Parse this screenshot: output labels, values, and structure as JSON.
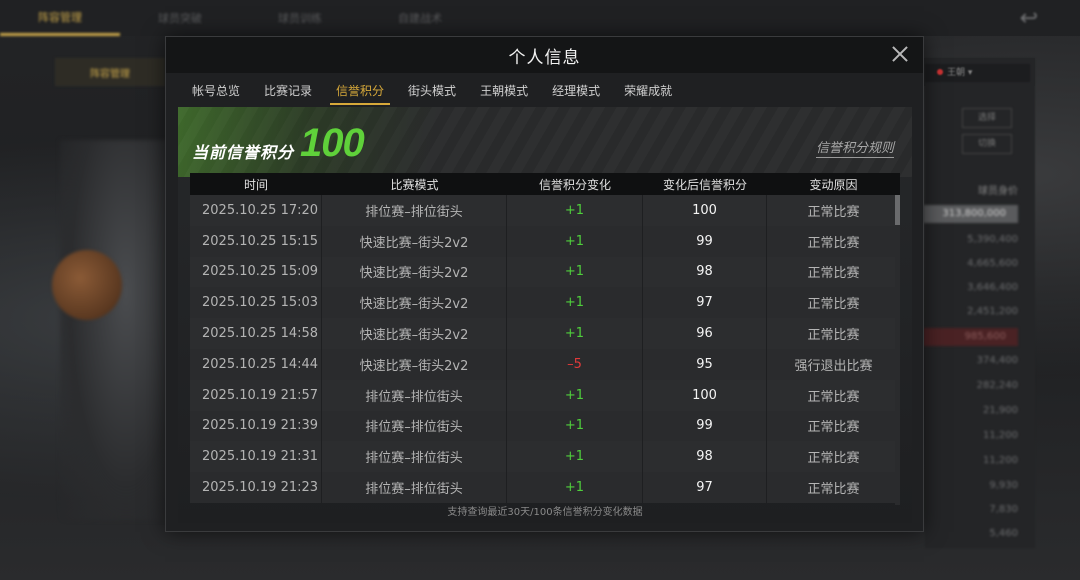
{
  "modal": {
    "title": "个人信息",
    "tabs": [
      {
        "label": "帐号总览",
        "active": false
      },
      {
        "label": "比赛记录",
        "active": false
      },
      {
        "label": "信誉积分",
        "active": true
      },
      {
        "label": "街头模式",
        "active": false
      },
      {
        "label": "王朝模式",
        "active": false
      },
      {
        "label": "经理模式",
        "active": false
      },
      {
        "label": "荣耀成就",
        "active": false
      }
    ],
    "score": {
      "label": "当前信誉积分",
      "value": "100"
    },
    "rules_link": "信誉积分规则",
    "table": {
      "headers": [
        "时间",
        "比赛模式",
        "信誉积分变化",
        "变化后信誉积分",
        "变动原因"
      ],
      "rows": [
        {
          "time": "2025.10.25  17:20",
          "mode": "排位赛–排位街头",
          "change": "+1",
          "after": "100",
          "reason": "正常比赛"
        },
        {
          "time": "2025.10.25  15:15",
          "mode": "快速比赛–街头2v2",
          "change": "+1",
          "after": "99",
          "reason": "正常比赛"
        },
        {
          "time": "2025.10.25  15:09",
          "mode": "快速比赛–街头2v2",
          "change": "+1",
          "after": "98",
          "reason": "正常比赛"
        },
        {
          "time": "2025.10.25  15:03",
          "mode": "快速比赛–街头2v2",
          "change": "+1",
          "after": "97",
          "reason": "正常比赛"
        },
        {
          "time": "2025.10.25  14:58",
          "mode": "快速比赛–街头2v2",
          "change": "+1",
          "after": "96",
          "reason": "正常比赛"
        },
        {
          "time": "2025.10.25  14:44",
          "mode": "快速比赛–街头2v2",
          "change": "–5",
          "after": "95",
          "reason": "强行退出比赛"
        },
        {
          "time": "2025.10.19  21:57",
          "mode": "排位赛–排位街头",
          "change": "+1",
          "after": "100",
          "reason": "正常比赛"
        },
        {
          "time": "2025.10.19  21:39",
          "mode": "排位赛–排位街头",
          "change": "+1",
          "after": "99",
          "reason": "正常比赛"
        },
        {
          "time": "2025.10.19  21:31",
          "mode": "排位赛–排位街头",
          "change": "+1",
          "after": "98",
          "reason": "正常比赛"
        },
        {
          "time": "2025.10.19  21:23",
          "mode": "排位赛–排位街头",
          "change": "+1",
          "after": "97",
          "reason": "正常比赛"
        }
      ]
    },
    "footer_note": "支持查询最近30天/100条信誉积分变化数据"
  },
  "colors": {
    "accent": "#d7a93a",
    "score_green": "#5fd13a",
    "positive": "#4fcf3c",
    "negative": "#e03a3a"
  },
  "background": {
    "top_tabs": [
      "阵容管理",
      "球员突破",
      "球员训练",
      "自建战术"
    ],
    "sub_tab": "阵容管理",
    "dropdown": "王朝",
    "buttons": [
      "选择",
      "切换"
    ],
    "right_header": "球员身价",
    "right_values": [
      "313,800,000",
      "5,390,400",
      "4,665,600",
      "3,646,400",
      "2,451,200",
      "985,600",
      "374,400",
      "282,240",
      "21,900",
      "11,200",
      "11,200",
      "9,930",
      "7,830",
      "5,460"
    ]
  }
}
